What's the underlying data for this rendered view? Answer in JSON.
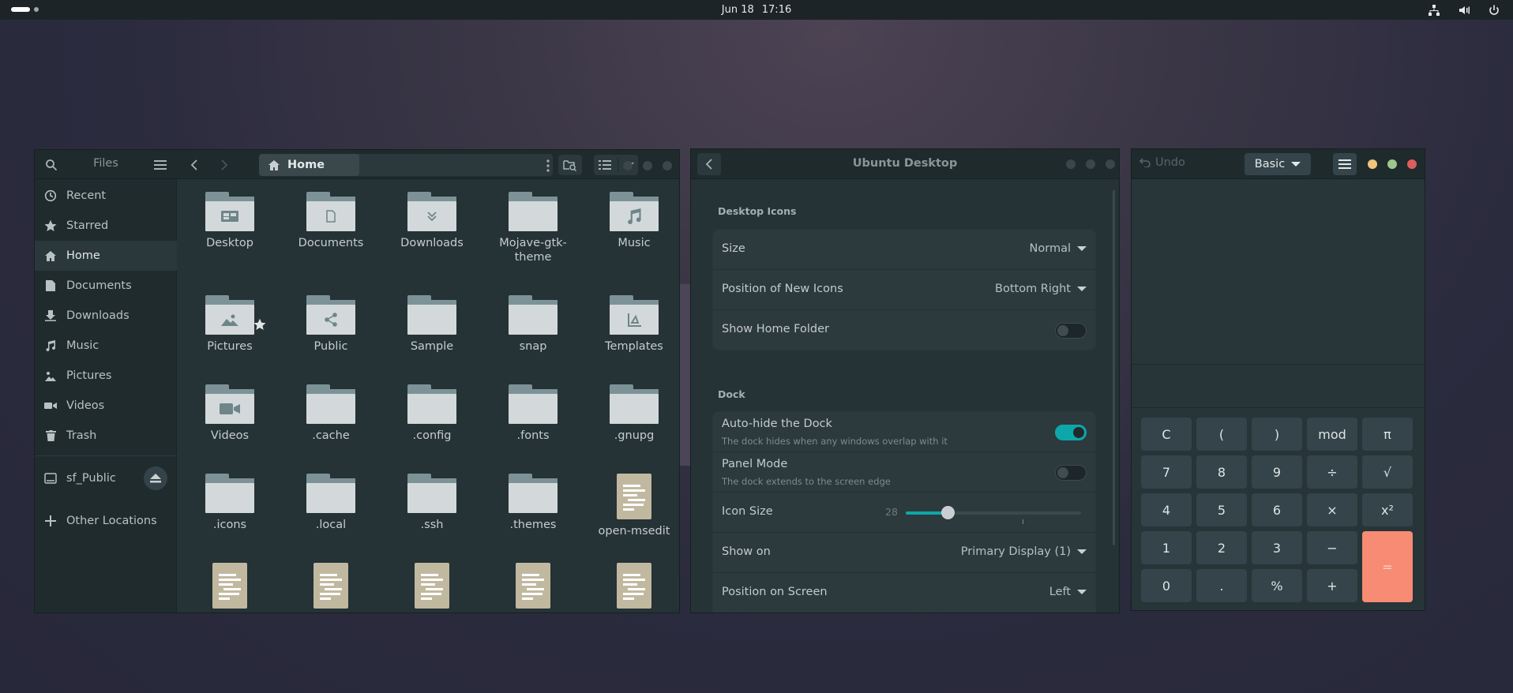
{
  "topbar": {
    "date": "Jun 18",
    "time": "17:16"
  },
  "files": {
    "title": "Files",
    "path_home": "Home",
    "sidebar": [
      {
        "label": "Recent",
        "icon": "clock-icon"
      },
      {
        "label": "Starred",
        "icon": "star-icon"
      },
      {
        "label": "Home",
        "icon": "home-icon"
      },
      {
        "label": "Documents",
        "icon": "document-icon"
      },
      {
        "label": "Downloads",
        "icon": "download-icon"
      },
      {
        "label": "Music",
        "icon": "music-icon"
      },
      {
        "label": "Pictures",
        "icon": "pictures-icon"
      },
      {
        "label": "Videos",
        "icon": "video-icon"
      },
      {
        "label": "Trash",
        "icon": "trash-icon"
      },
      {
        "label": "sf_Public",
        "icon": "drive-icon"
      },
      {
        "label": "Other Locations",
        "icon": "plus-icon"
      }
    ],
    "items": [
      {
        "label": "Desktop",
        "kind": "folder",
        "emblem": "desktop"
      },
      {
        "label": "Documents",
        "kind": "folder",
        "emblem": "document"
      },
      {
        "label": "Downloads",
        "kind": "folder",
        "emblem": "download"
      },
      {
        "label": "Mojave-gtk-theme",
        "kind": "folder",
        "emblem": ""
      },
      {
        "label": "Music",
        "kind": "folder",
        "emblem": "music"
      },
      {
        "label": "Pictures",
        "kind": "folder",
        "emblem": "pictures"
      },
      {
        "label": "Public",
        "kind": "folder",
        "emblem": "share"
      },
      {
        "label": "Sample",
        "kind": "folder",
        "emblem": ""
      },
      {
        "label": "snap",
        "kind": "folder",
        "emblem": ""
      },
      {
        "label": "Templates",
        "kind": "folder",
        "emblem": "templates"
      },
      {
        "label": "Videos",
        "kind": "folder",
        "emblem": "video"
      },
      {
        "label": ".cache",
        "kind": "folder",
        "emblem": ""
      },
      {
        "label": ".config",
        "kind": "folder",
        "emblem": ""
      },
      {
        "label": ".fonts",
        "kind": "folder",
        "emblem": ""
      },
      {
        "label": ".gnupg",
        "kind": "folder",
        "emblem": ""
      },
      {
        "label": ".icons",
        "kind": "folder",
        "emblem": ""
      },
      {
        "label": ".local",
        "kind": "folder",
        "emblem": ""
      },
      {
        "label": ".ssh",
        "kind": "folder",
        "emblem": ""
      },
      {
        "label": ".themes",
        "kind": "folder",
        "emblem": ""
      },
      {
        "label": "open-msedit",
        "kind": "document",
        "emblem": ""
      },
      {
        "label": "",
        "kind": "document",
        "emblem": ""
      },
      {
        "label": "",
        "kind": "document",
        "emblem": ""
      },
      {
        "label": "",
        "kind": "document",
        "emblem": ""
      },
      {
        "label": "",
        "kind": "document",
        "emblem": ""
      },
      {
        "label": "",
        "kind": "document",
        "emblem": ""
      }
    ]
  },
  "settings": {
    "title": "Ubuntu Desktop",
    "desktop_icons_header": "Desktop Icons",
    "size_label": "Size",
    "size_value": "Normal",
    "position_label": "Position of New Icons",
    "position_value": "Bottom Right",
    "show_home_label": "Show Home Folder",
    "show_home": false,
    "dock_header": "Dock",
    "autohide_label": "Auto-hide the Dock",
    "autohide_sub": "The dock hides when any windows overlap with it",
    "autohide": true,
    "panel_label": "Panel Mode",
    "panel_sub": "The dock extends to the screen edge",
    "panel": false,
    "iconsize_label": "Icon Size",
    "iconsize_value": "28",
    "iconsize_fraction": 0.24,
    "showon_label": "Show on",
    "showon_value": "Primary Display (1)",
    "position_screen_label": "Position on Screen",
    "position_screen_value": "Left"
  },
  "calc": {
    "undo": "Undo",
    "mode": "Basic",
    "keys": [
      [
        "C",
        "(",
        ")",
        "mod",
        "π"
      ],
      [
        "7",
        "8",
        "9",
        "÷",
        "√"
      ],
      [
        "4",
        "5",
        "6",
        "×",
        "x²"
      ],
      [
        "1",
        "2",
        "3",
        "−",
        "="
      ],
      [
        "0",
        ".",
        "%",
        "+"
      ]
    ]
  }
}
